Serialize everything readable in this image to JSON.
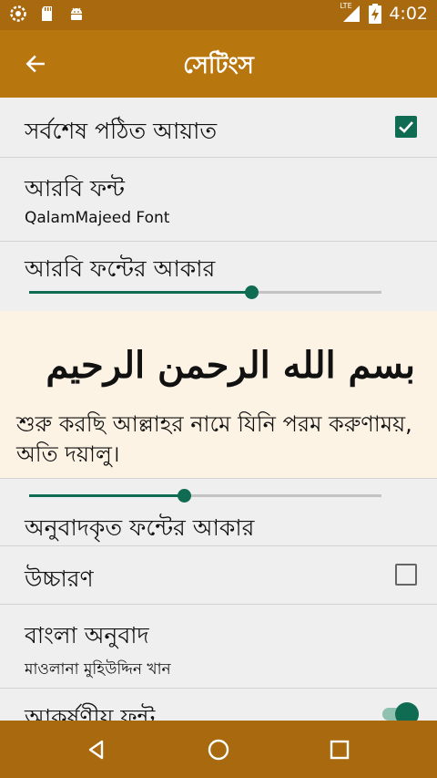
{
  "status_bar": {
    "left_icons": [
      "settings-icon",
      "sd-card-icon",
      "android-icon"
    ],
    "network": "LTE",
    "battery_icon": "battery-charging-icon",
    "time": "4:02"
  },
  "app_bar": {
    "back_icon": "arrow-left-icon",
    "title": "সেটিংস"
  },
  "settings": {
    "last_read": {
      "label": "সর্বশেষ পঠিত আয়াত",
      "checked": true
    },
    "arabic_font": {
      "label": "আরবি ফন্ট",
      "value": "QalamMajeed Font"
    },
    "arabic_font_size": {
      "label": "আরবি ফন্টের আকার",
      "slider_fraction": 0.63
    },
    "preview": {
      "arabic": "بسم الله الرحمن الرحيم",
      "translation": "শুরু করছি আল্লাহর নামে যিনি পরম করুণাময়, অতি দয়ালু।"
    },
    "translation_font_size": {
      "label": "অনুবাদকৃত ফন্টের আকার",
      "slider_fraction": 0.44
    },
    "pronunciation": {
      "label": "উচ্চারণ",
      "checked": false
    },
    "bangla_translation": {
      "label": "বাংলা অনুবাদ",
      "value": "মাওলানা মুহিউদ্দিন খান"
    },
    "attractive_font": {
      "label": "আকর্ষণীয় ফন্ট",
      "enabled": true
    }
  },
  "colors": {
    "app_bar": "#b8760e",
    "status_bar": "#a8690f",
    "accent": "#0f6b52",
    "preview_bg": "#fcf3e4"
  },
  "nav_bar": {
    "back_icon": "triangle-back-icon",
    "home_icon": "circle-home-icon",
    "recents_icon": "square-recents-icon"
  }
}
